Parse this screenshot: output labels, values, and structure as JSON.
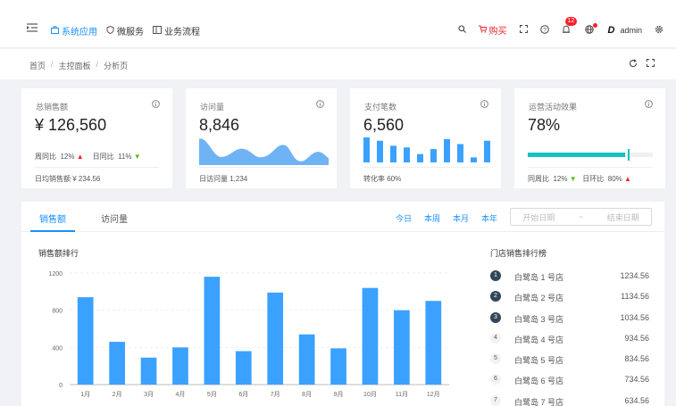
{
  "header": {
    "nav": [
      {
        "label": "系统应用",
        "icon": "appstore-icon",
        "active": true
      },
      {
        "label": "微服务",
        "icon": "shield-icon",
        "active": false
      },
      {
        "label": "业务流程",
        "icon": "flow-icon",
        "active": false
      }
    ],
    "buy_label": "购买",
    "notification_count": "12",
    "username": "admin",
    "logo_letter": "D"
  },
  "breadcrumb": [
    "首页",
    "主控面板",
    "分析页"
  ],
  "cards": [
    {
      "title": "总销售额",
      "value": "¥ 126,560",
      "trend1_label": "周同比",
      "trend1_value": "12%",
      "trend2_label": "日同比",
      "trend2_value": "11%",
      "footer": "日均销售额 ¥ 234.56"
    },
    {
      "title": "访问量",
      "value": "8,846",
      "footer": "日访问量 1,234"
    },
    {
      "title": "支付笔数",
      "value": "6,560",
      "footer": "转化率 60%"
    },
    {
      "title": "运营活动效果",
      "value": "78%",
      "progress": 0.78,
      "target": 0.8,
      "trend1_label": "同周比",
      "trend1_value": "12%",
      "trend2_label": "日环比",
      "trend2_value": "80%"
    }
  ],
  "colors": {
    "primary": "#1890ff",
    "bar": "#3ba1ff",
    "area": "#975fe4",
    "progress": "#13c2c2",
    "up": "#f5222d",
    "down": "#52c41a"
  },
  "tabs": [
    {
      "label": "销售额",
      "active": true
    },
    {
      "label": "访问量",
      "active": false
    }
  ],
  "periods": [
    "今日",
    "本周",
    "本月",
    "本年"
  ],
  "range": {
    "start": "开始日期",
    "sep": "~",
    "end": "结束日期"
  },
  "chart_title": "销售额排行",
  "chart_data": {
    "type": "bar",
    "title": "销售额排行",
    "categories": [
      "1月",
      "2月",
      "3月",
      "4月",
      "5月",
      "6月",
      "7月",
      "8月",
      "9月",
      "10月",
      "11月",
      "12月"
    ],
    "values": [
      940,
      460,
      290,
      400,
      1160,
      360,
      990,
      540,
      390,
      1040,
      800,
      900
    ],
    "ylim": [
      0,
      1200
    ],
    "yticks": [
      0,
      400,
      800,
      1200
    ]
  },
  "rank_title": "门店销售排行榜",
  "ranking": [
    {
      "rank": "1",
      "name": "白鹭岛 1 号店",
      "value": "1234.56"
    },
    {
      "rank": "2",
      "name": "白鹭岛 2 号店",
      "value": "1134.56"
    },
    {
      "rank": "3",
      "name": "白鹭岛 3 号店",
      "value": "1034.56"
    },
    {
      "rank": "4",
      "name": "白鹭岛 4 号店",
      "value": "934.56"
    },
    {
      "rank": "5",
      "name": "白鹭岛 5 号店",
      "value": "834.56"
    },
    {
      "rank": "6",
      "name": "白鹭岛 6 号店",
      "value": "734.56"
    },
    {
      "rank": "7",
      "name": "白鹭岛 7 号店",
      "value": "634.56"
    }
  ]
}
